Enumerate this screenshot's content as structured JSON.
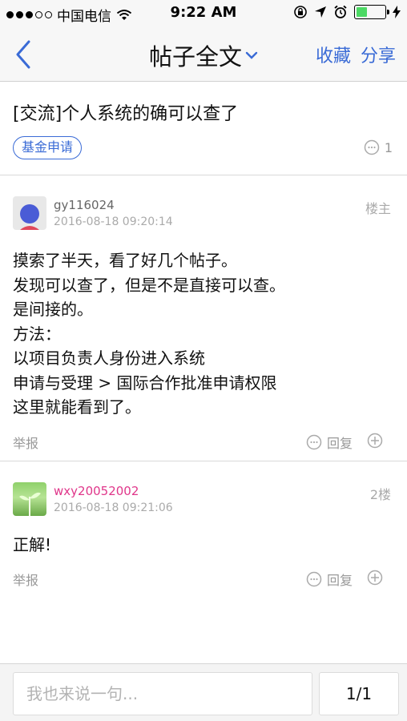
{
  "status_bar": {
    "carrier": "中国电信",
    "time": "9:22 AM"
  },
  "nav": {
    "title": "帖子全文",
    "favorite_label": "收藏",
    "share_label": "分享"
  },
  "post_header": {
    "title": "[交流]个人系统的确可以查了",
    "tag": "基金申请",
    "comment_count": "1"
  },
  "posts": [
    {
      "username": "gy116024",
      "time": "2016-08-18 09:20:14",
      "floor": "楼主",
      "content": [
        "摸索了半天，看了好几个帖子。",
        "发现可以查了，但是不是直接可以查。",
        "是间接的。",
        "方法：",
        "以项目负责人身份进入系统",
        "申请与受理 > 国际合作批准申请权限",
        "这里就能看到了。"
      ],
      "report_label": "举报",
      "reply_label": "回复"
    },
    {
      "username": "wxy20052002",
      "time": "2016-08-18 09:21:06",
      "floor": "2楼",
      "content": [
        "正解!"
      ],
      "report_label": "举报",
      "reply_label": "回复"
    }
  ],
  "bottom_bar": {
    "input_placeholder": "我也来说一句...",
    "page_indicator": "1/1"
  },
  "colors": {
    "accent": "#3a6bd6",
    "username_highlight": "#e0368a",
    "battery": "#4cd964"
  },
  "icons": {
    "back": "chevron-left-icon",
    "dropdown": "chevron-down-icon",
    "comment": "comment-bubble-icon",
    "add": "plus-circle-icon"
  }
}
